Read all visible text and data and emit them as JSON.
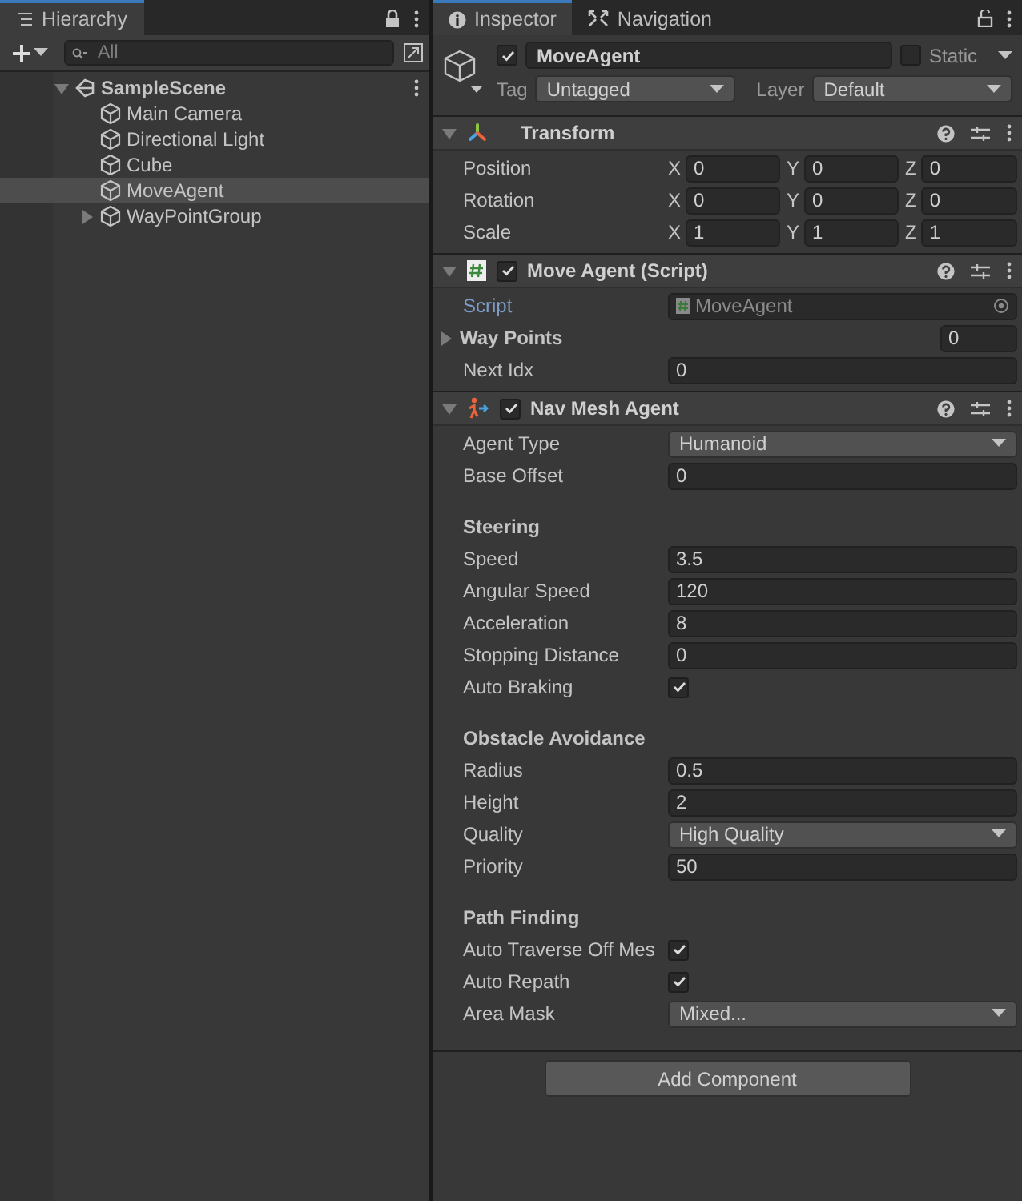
{
  "hierarchy": {
    "tab": "Hierarchy",
    "search": {
      "placeholder": "All"
    },
    "tree": [
      {
        "label": "SampleScene",
        "kind": "scene",
        "expanded": true,
        "selected": false,
        "children": [
          {
            "label": "Main Camera",
            "kind": "object",
            "selected": false
          },
          {
            "label": "Directional Light",
            "kind": "object",
            "selected": false
          },
          {
            "label": "Cube",
            "kind": "object",
            "selected": false
          },
          {
            "label": "MoveAgent",
            "kind": "object",
            "selected": true
          },
          {
            "label": "WayPointGroup",
            "kind": "object",
            "expanded": false,
            "selected": false
          }
        ]
      }
    ]
  },
  "inspector": {
    "tabs": [
      {
        "label": "Inspector",
        "selected": true
      },
      {
        "label": "Navigation",
        "selected": false
      }
    ],
    "object": {
      "active": true,
      "name": "MoveAgent",
      "static": false,
      "static_label": "Static",
      "tag_label": "Tag",
      "tag": "Untagged",
      "layer_label": "Layer",
      "layer": "Default"
    },
    "components": [
      {
        "title": "Transform",
        "kind": "transform",
        "expanded": true,
        "rows": [
          {
            "kind": "vector3",
            "label": "Position",
            "axes": [
              {
                "axis": "X",
                "value": "0"
              },
              {
                "axis": "Y",
                "value": "0"
              },
              {
                "axis": "Z",
                "value": "0"
              }
            ]
          },
          {
            "kind": "vector3",
            "label": "Rotation",
            "axes": [
              {
                "axis": "X",
                "value": "0"
              },
              {
                "axis": "Y",
                "value": "0"
              },
              {
                "axis": "Z",
                "value": "0"
              }
            ]
          },
          {
            "kind": "vector3",
            "label": "Scale",
            "axes": [
              {
                "axis": "X",
                "value": "1"
              },
              {
                "axis": "Y",
                "value": "1"
              },
              {
                "axis": "Z",
                "value": "1"
              }
            ]
          }
        ]
      },
      {
        "title": "Move Agent (Script)",
        "kind": "script",
        "enabled": true,
        "expanded": true,
        "rows": [
          {
            "kind": "object",
            "label": "Script",
            "value": "MoveAgent"
          },
          {
            "kind": "array",
            "label": "Way Points",
            "value": "0",
            "expanded": false
          },
          {
            "kind": "field",
            "label": "Next Idx",
            "value": "0"
          }
        ]
      },
      {
        "title": "Nav Mesh Agent",
        "kind": "navagent",
        "enabled": true,
        "expanded": true,
        "rows": [
          {
            "kind": "dropdown",
            "label": "Agent Type",
            "value": "Humanoid"
          },
          {
            "kind": "field",
            "label": "Base Offset",
            "value": "0"
          },
          {
            "kind": "header",
            "label": "Steering"
          },
          {
            "kind": "field",
            "label": "Speed",
            "value": "3.5"
          },
          {
            "kind": "field",
            "label": "Angular Speed",
            "value": "120"
          },
          {
            "kind": "field",
            "label": "Acceleration",
            "value": "8"
          },
          {
            "kind": "field",
            "label": "Stopping Distance",
            "value": "0"
          },
          {
            "kind": "toggle",
            "label": "Auto Braking",
            "checked": true
          },
          {
            "kind": "header",
            "label": "Obstacle Avoidance"
          },
          {
            "kind": "field",
            "label": "Radius",
            "value": "0.5"
          },
          {
            "kind": "field",
            "label": "Height",
            "value": "2"
          },
          {
            "kind": "dropdown",
            "label": "Quality",
            "value": "High Quality"
          },
          {
            "kind": "field",
            "label": "Priority",
            "value": "50"
          },
          {
            "kind": "header",
            "label": "Path Finding"
          },
          {
            "kind": "toggle",
            "label": "Auto Traverse Off Mes",
            "checked": true
          },
          {
            "kind": "toggle",
            "label": "Auto Repath",
            "checked": true
          },
          {
            "kind": "dropdown",
            "label": "Area Mask",
            "value": "Mixed..."
          }
        ]
      }
    ],
    "add_button": "Add Component"
  }
}
